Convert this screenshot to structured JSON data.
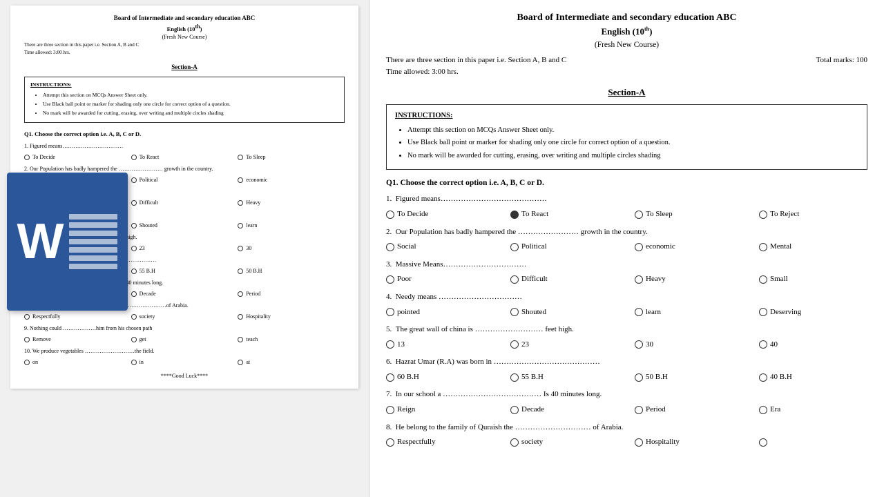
{
  "document": {
    "title": "Board of Intermediate and secondary education ABC",
    "subtitle": "English (10",
    "subtitle_sup": "th",
    "subtitle_end": ")",
    "course": "(Fresh New Course)",
    "info_left": "There are three section in this paper i.e. Section A, B and C",
    "info_right": "Total marks: 100",
    "time": "Time allowed: 3:00 hrs.",
    "section_heading": "Section-A",
    "instructions": {
      "title": "INSTRUCTIONS:",
      "items": [
        "Attempt this section on MCQs Answer Sheet only.",
        "Use Black ball point or marker for shading only one circle for correct option of a question.",
        "No mark will be awarded for cutting, erasing, over writing and multiple circles shading"
      ]
    },
    "q1_label": "Q1.    Choose the correct option i.e. A, B, C or D.",
    "questions": [
      {
        "num": "1.",
        "text": "Figured means……………………………………",
        "options": [
          "To Decide",
          "To React",
          "To Sleep",
          "To Reject"
        ]
      },
      {
        "num": "2.",
        "text": "Our Population has badly hampered the …………………… growth in the country.",
        "options": [
          "Social",
          "Political",
          "economic",
          "Mental"
        ]
      },
      {
        "num": "3.",
        "text": "Massive Means……………………………",
        "options": [
          "Poor",
          "Difficult",
          "Heavy",
          "Small"
        ]
      },
      {
        "num": "4.",
        "text": "Needy means ……………………………",
        "options": [
          "pointed",
          "Shouted",
          "learn",
          "Deserving"
        ]
      },
      {
        "num": "5.",
        "text": "The great wall of china is ……………………… feet high.",
        "options": [
          "13",
          "23",
          "30",
          "40"
        ]
      },
      {
        "num": "6.",
        "text": "Hazrat Umar (R.A) was born in ……………………………………",
        "options": [
          "60 B.H",
          "55 B.H",
          "50 B.H",
          "40 B.H"
        ]
      },
      {
        "num": "7.",
        "text": "In our school a ………………………………… Is 40 minutes long.",
        "options": [
          "Reign",
          "Decade",
          "Period",
          "Era"
        ]
      },
      {
        "num": "8.",
        "text": "He belong to the family of Quraish the ………………………… of Arabia.",
        "options": [
          "Respectfully",
          "society",
          "Hospitality",
          ""
        ]
      }
    ],
    "good_luck": "****Good Luck****"
  },
  "left_doc": {
    "q1_label": "Q1.    Choose the correct option i.e. A, B, C or D.",
    "questions": [
      {
        "num": "1.",
        "text": "Figured means……………………………",
        "options": [
          "To Decide",
          "To React",
          "To Sleep",
          ""
        ]
      },
      {
        "num": "2.",
        "text": "Our Population has badly hampered the …………………… growth in the country.",
        "options": [
          "",
          "Political",
          "economic",
          ""
        ]
      },
      {
        "num": "3.",
        "text": "…………………………………",
        "options": [
          "",
          "Difficult",
          "Heavy",
          ""
        ]
      },
      {
        "num": "4.",
        "text": "……………………………………",
        "options": [
          "",
          "Shouted",
          "learn",
          ""
        ]
      },
      {
        "num": "5.",
        "text": "…of china is ………………………… feet high.",
        "options": [
          "13",
          "23",
          "30",
          ""
        ]
      },
      {
        "num": "6.",
        "text": "Hazrat Umar (R.A) was born in …………………………",
        "options": [
          "60 B.H",
          "55 B.H",
          "50 B.H",
          ""
        ]
      },
      {
        "num": "7.",
        "text": "In our school a ………………………… Is 40 minutes long.",
        "options": [
          "Reign",
          "Decade",
          "Period",
          ""
        ]
      },
      {
        "num": "8.",
        "text": "He belong to the family of Quraish the ………………………of Arabia.",
        "options": [
          "Respectfully",
          "society",
          "Hospitality",
          ""
        ]
      },
      {
        "num": "9.",
        "text": "Nothing could ………………him from his chosen path",
        "options": [
          "Remove",
          "get",
          "teach",
          ""
        ]
      },
      {
        "num": "10.",
        "text": "We produce vegetables ………………………the field.",
        "options": [
          "on",
          "in",
          "at",
          ""
        ]
      }
    ],
    "good_luck": "****Good Luck****"
  }
}
